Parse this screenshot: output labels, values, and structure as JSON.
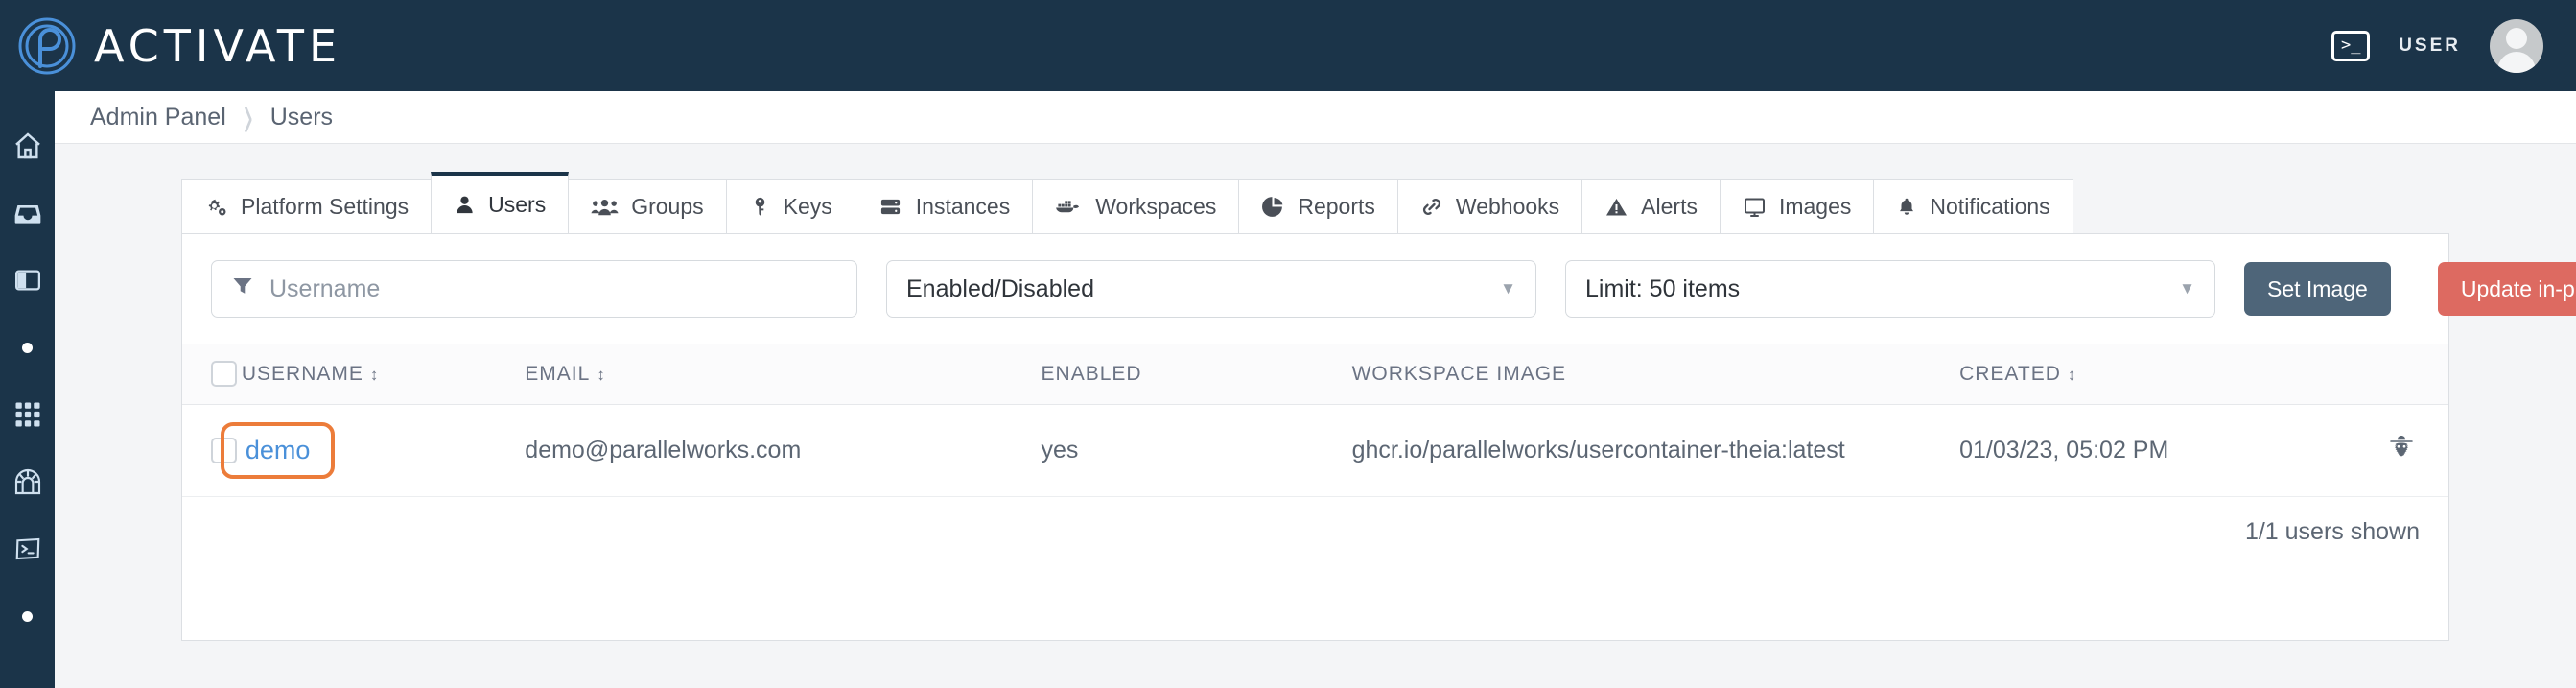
{
  "brand": {
    "name": "ACTIVATE",
    "logo_icon": "fingerprint-p-logo",
    "bar_color": "#1b3449"
  },
  "topbar": {
    "terminal_icon": "terminal-icon",
    "terminal_glyph": ">_",
    "user_label": "USER",
    "avatar_icon": "user-avatar"
  },
  "sidebar": {
    "items": [
      {
        "icon": "home-icon",
        "name": "sidebar-item-home"
      },
      {
        "icon": "inbox-icon",
        "name": "sidebar-item-inbox"
      },
      {
        "icon": "panel-icon",
        "name": "sidebar-item-panel"
      },
      {
        "icon": "dot-icon",
        "name": "sidebar-item-dot-1"
      },
      {
        "icon": "grid-icon",
        "name": "sidebar-item-grid"
      },
      {
        "icon": "tunnel-icon",
        "name": "sidebar-item-tunnel"
      },
      {
        "icon": "terminal-icon",
        "name": "sidebar-item-terminal"
      },
      {
        "icon": "dot-icon",
        "name": "sidebar-item-dot-2"
      }
    ]
  },
  "breadcrumb": {
    "parent": "Admin Panel",
    "separator": "›",
    "current": "Users"
  },
  "tabs": [
    {
      "label": "Platform Settings",
      "icon": "gears-icon",
      "active": false
    },
    {
      "label": "Users",
      "icon": "user-icon",
      "active": true
    },
    {
      "label": "Groups",
      "icon": "users-group-icon",
      "active": false
    },
    {
      "label": "Keys",
      "icon": "key-icon",
      "active": false
    },
    {
      "label": "Instances",
      "icon": "server-icon",
      "active": false
    },
    {
      "label": "Workspaces",
      "icon": "docker-whale-icon",
      "active": false
    },
    {
      "label": "Reports",
      "icon": "pie-chart-icon",
      "active": false
    },
    {
      "label": "Webhooks",
      "icon": "link-icon",
      "active": false
    },
    {
      "label": "Alerts",
      "icon": "warning-icon",
      "active": false
    },
    {
      "label": "Images",
      "icon": "monitor-icon",
      "active": false
    },
    {
      "label": "Notifications",
      "icon": "bell-icon",
      "active": false
    }
  ],
  "filters": {
    "username": {
      "value": "",
      "placeholder": "Username",
      "icon": "filter-icon"
    },
    "status": {
      "selected": "Enabled/Disabled",
      "caret": "▼"
    },
    "limit": {
      "selected": "Limit: 50 items",
      "caret": "▼"
    },
    "set_image_label": "Set Image",
    "update_label": "Update in-place",
    "set_image_color": "#4e6579",
    "update_color": "#dd6a61"
  },
  "table": {
    "columns": [
      {
        "label": "",
        "sortable": false
      },
      {
        "label": "USERNAME",
        "sortable": true
      },
      {
        "label": "EMAIL",
        "sortable": true
      },
      {
        "label": "ENABLED",
        "sortable": false
      },
      {
        "label": "WORKSPACE IMAGE",
        "sortable": false
      },
      {
        "label": "CREATED",
        "sortable": true
      },
      {
        "label": "",
        "sortable": false
      }
    ],
    "sort_glyph": "↕",
    "rows": [
      {
        "username": "demo",
        "username_highlighted": true,
        "highlight_color": "#ec7c3a",
        "email": "demo@parallelworks.com",
        "enabled": "yes",
        "workspace_image": "ghcr.io/parallelworks/usercontainer-theia:latest",
        "created": "01/03/23, 05:02 PM",
        "action_icon": "impersonate-spy-icon"
      }
    ],
    "footer_count": "1/1 users shown"
  }
}
